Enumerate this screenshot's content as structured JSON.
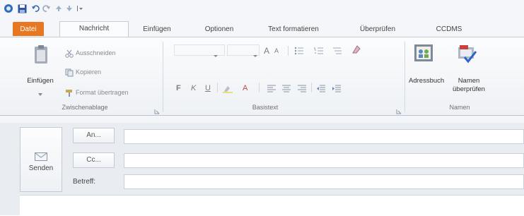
{
  "quick_access": {
    "icons": [
      "outlook-icon",
      "save-icon",
      "undo-icon",
      "redo-icon",
      "up-arrow-icon",
      "down-arrow-icon",
      "customize-qat-icon"
    ]
  },
  "tabs": [
    {
      "label": "Datei"
    },
    {
      "label": "Nachricht"
    },
    {
      "label": "Einfügen"
    },
    {
      "label": "Optionen"
    },
    {
      "label": "Text formatieren"
    },
    {
      "label": "Überprüfen"
    },
    {
      "label": "CCDMS"
    }
  ],
  "ribbon": {
    "clipboard": {
      "paste_label": "Einfügen",
      "cut_label": "Ausschneiden",
      "copy_label": "Kopieren",
      "format_painter_label": "Format übertragen",
      "group_label": "Zwischenablage"
    },
    "basic_text": {
      "group_label": "Basistext",
      "font_grow": "A",
      "font_shrink": "A",
      "bold": "F",
      "italic": "K",
      "underline": "U",
      "font_color": "A"
    },
    "names": {
      "address_book_label": "Adressbuch",
      "check_names_label_1": "Namen",
      "check_names_label_2": "überprüfen",
      "group_label": "Namen"
    }
  },
  "compose": {
    "send_label": "Senden",
    "to_label": "An...",
    "cc_label": "Cc...",
    "subject_label": "Betreff:",
    "to_value": "",
    "cc_value": "",
    "subject_value": ""
  },
  "colors": {
    "file_tab": "#e87722",
    "ribbon_bg": "#f4f6f9",
    "compose_bg": "#e9ecf1"
  }
}
